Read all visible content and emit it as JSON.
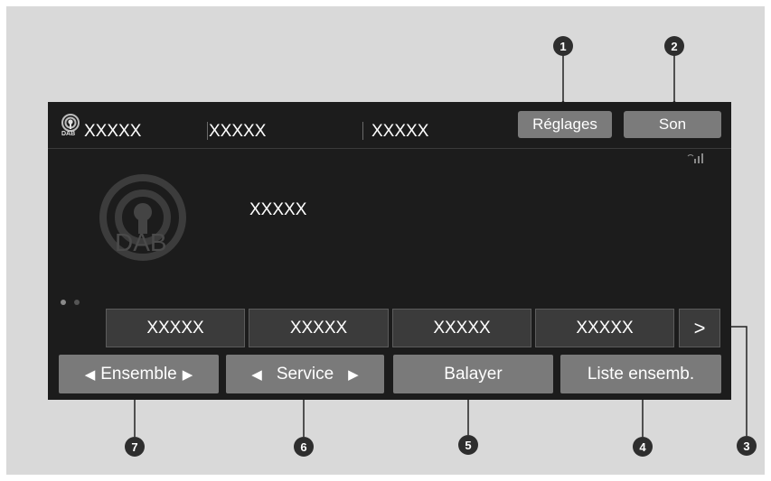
{
  "status_bar": {
    "tabs": [
      "XXXXX",
      "XXXXX",
      "XXXXX"
    ],
    "dab_small_label": "DAB",
    "settings_label": "Réglages",
    "sound_label": "Son"
  },
  "main": {
    "dab_logo_label": "DAB",
    "station_text": "XXXXX"
  },
  "presets": {
    "items": [
      "XXXXX",
      "XXXXX",
      "XXXXX",
      "XXXXX"
    ],
    "next_glyph": ">"
  },
  "bottom": {
    "ensemble_label": "Ensemble",
    "service_label": "Service",
    "scan_label": "Balayer",
    "list_label": "Liste ensemb."
  },
  "callouts": [
    "1",
    "2",
    "3",
    "4",
    "5",
    "6",
    "7"
  ]
}
